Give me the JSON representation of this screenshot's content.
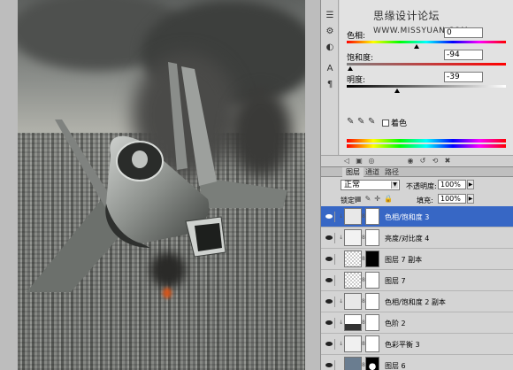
{
  "canvas": {
    "image_alt": "fighter jet over city with smoke"
  },
  "rail_icons": [
    "levels-icon",
    "curves-icon",
    "hue-icon",
    "text-tool-icon",
    "paragraph-icon"
  ],
  "watermark": {
    "text": "思缘设计论坛",
    "url": "WWW.MISSYUAN.COM"
  },
  "adjustments": {
    "hue": {
      "label": "色相:",
      "value": "0"
    },
    "saturation": {
      "label": "饱和度:",
      "value": "-94"
    },
    "lightness": {
      "label": "明度:",
      "value": "-39"
    },
    "colorize_label": "着色"
  },
  "layers_panel": {
    "tabs": [
      "图层",
      "通道",
      "路径"
    ],
    "blend_mode": "正常",
    "opacity_label": "不透明度:",
    "opacity_value": "100%",
    "lock_label": "锁定:",
    "fill_label": "填充:",
    "fill_value": "100%",
    "layers": [
      {
        "name": "色相/饱和度 3",
        "selected": true
      },
      {
        "name": "亮度/对比度 4",
        "selected": false
      },
      {
        "name": "图层 7 副本",
        "selected": false
      },
      {
        "name": "图层 7",
        "selected": false
      },
      {
        "name": "色相/饱和度 2 副本",
        "selected": false
      },
      {
        "name": "色阶 2",
        "selected": false
      },
      {
        "name": "色彩平衡 3",
        "selected": false
      },
      {
        "name": "图层 6",
        "selected": false
      }
    ]
  }
}
